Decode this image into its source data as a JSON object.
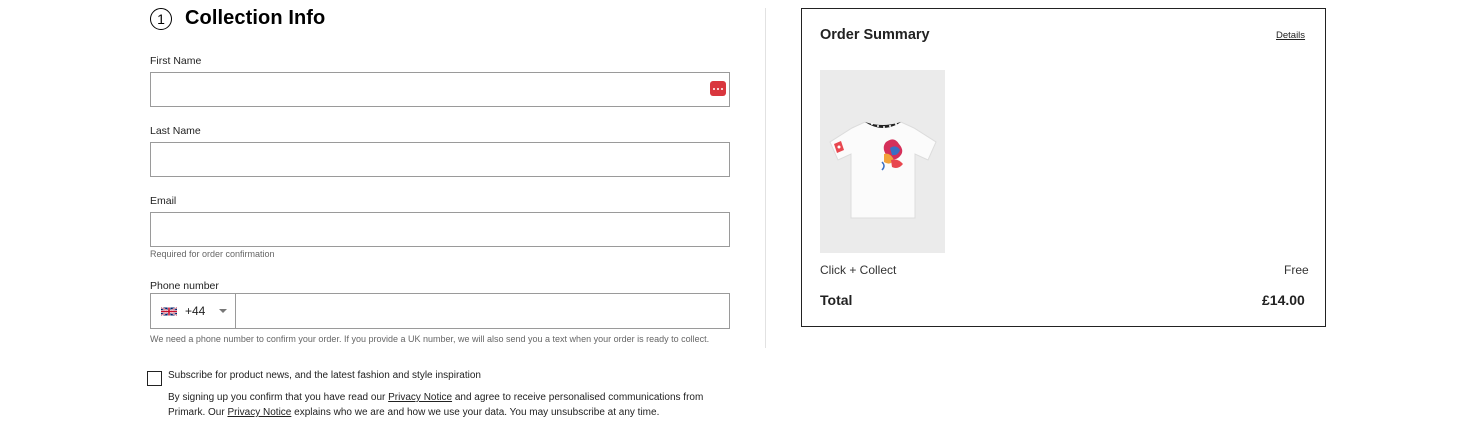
{
  "form": {
    "step_number": "1",
    "title": "Collection Info",
    "first_name": {
      "label": "First Name",
      "value": ""
    },
    "last_name": {
      "label": "Last Name",
      "value": ""
    },
    "email": {
      "label": "Email",
      "value": "",
      "hint": "Required for order confirmation"
    },
    "phone": {
      "label": "Phone number",
      "country_code": "+44",
      "country_flag_icon": "uk-flag-icon",
      "value": "",
      "hint": "We need a phone number to confirm your order. If you provide a UK number, we will also send you a text when your order is ready to collect."
    },
    "subscribe": {
      "checked": false,
      "label": "Subscribe for product news, and the latest fashion and style inspiration",
      "legal_1": "By signing up you confirm that you have read our ",
      "privacy_link_1": "Privacy Notice",
      "legal_2": " and agree to receive personalised communications from Primark. Our ",
      "privacy_link_2": "Privacy Notice",
      "legal_3": " explains who we are and how we use your data. You may unsubscribe at any time."
    },
    "password_manager_icon": "password-manager-icon",
    "accent_color": "#d9363e"
  },
  "summary": {
    "title": "Order Summary",
    "details_link": "Details",
    "product_image": "white t-shirt with graphic print",
    "delivery_label": "Click + Collect",
    "delivery_price": "Free",
    "total_label": "Total",
    "total_value": "£14.00"
  }
}
